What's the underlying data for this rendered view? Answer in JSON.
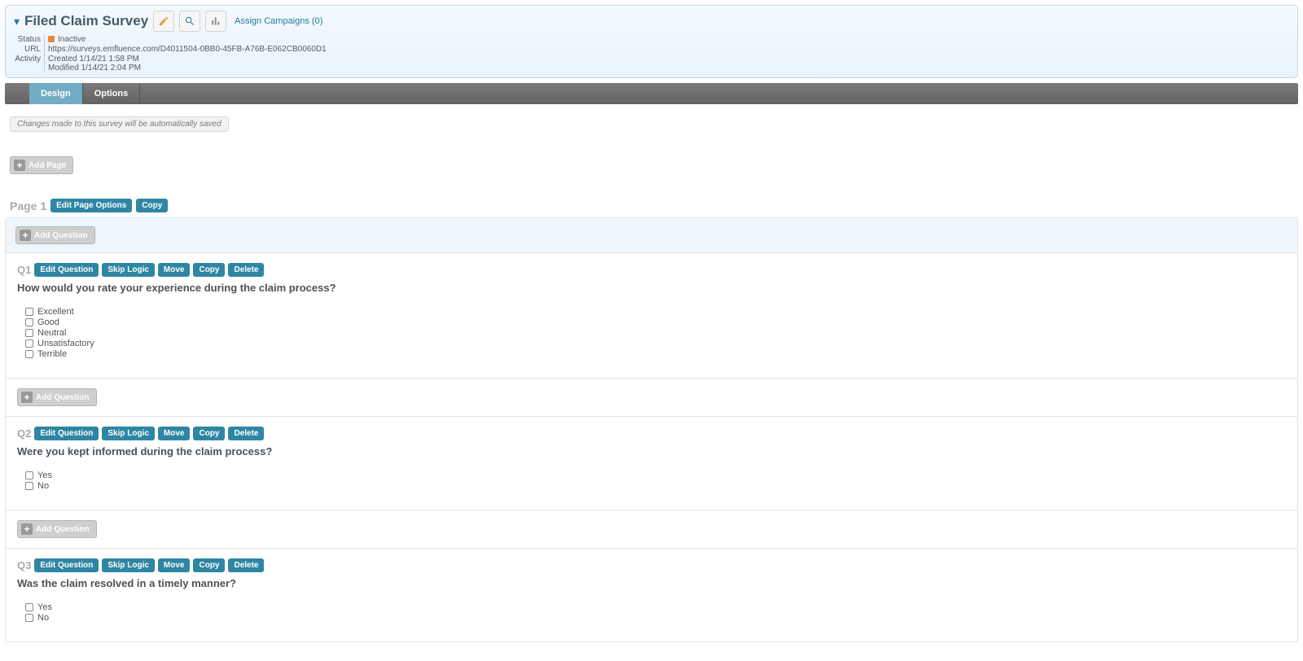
{
  "header": {
    "title": "Filed Claim Survey",
    "assign_campaigns": "Assign Campaigns (0)",
    "status_label": "Status",
    "status_value": "Inactive",
    "url_label": "URL",
    "url_value": "https://surveys.emfluence.com/D4011504-0BB0-45FB-A76B-E062CB0060D1",
    "activity_label": "Activity",
    "created": "Created 1/14/21 1:58 PM",
    "modified": "Modified 1/14/21 2:04 PM"
  },
  "tabs": {
    "design": "Design",
    "options": "Options"
  },
  "autosave": "Changes made to this survey will be automatically saved",
  "buttons": {
    "add_page": "Add Page",
    "add_question": "Add Question",
    "edit_page_options": "Edit Page Options",
    "copy": "Copy",
    "edit_question": "Edit Question",
    "skip_logic": "Skip Logic",
    "move": "Move",
    "delete": "Delete"
  },
  "page": {
    "label": "Page 1"
  },
  "questions": [
    {
      "num": "Q1",
      "text": "How would you rate your experience during the claim process?",
      "options": [
        "Excellent",
        "Good",
        "Neutral",
        "Unsatisfactory",
        "Terrible"
      ]
    },
    {
      "num": "Q2",
      "text": "Were you kept informed during the claim process?",
      "options": [
        "Yes",
        "No"
      ]
    },
    {
      "num": "Q3",
      "text": "Was the claim resolved in a timely manner?",
      "options": [
        "Yes",
        "No"
      ]
    }
  ]
}
